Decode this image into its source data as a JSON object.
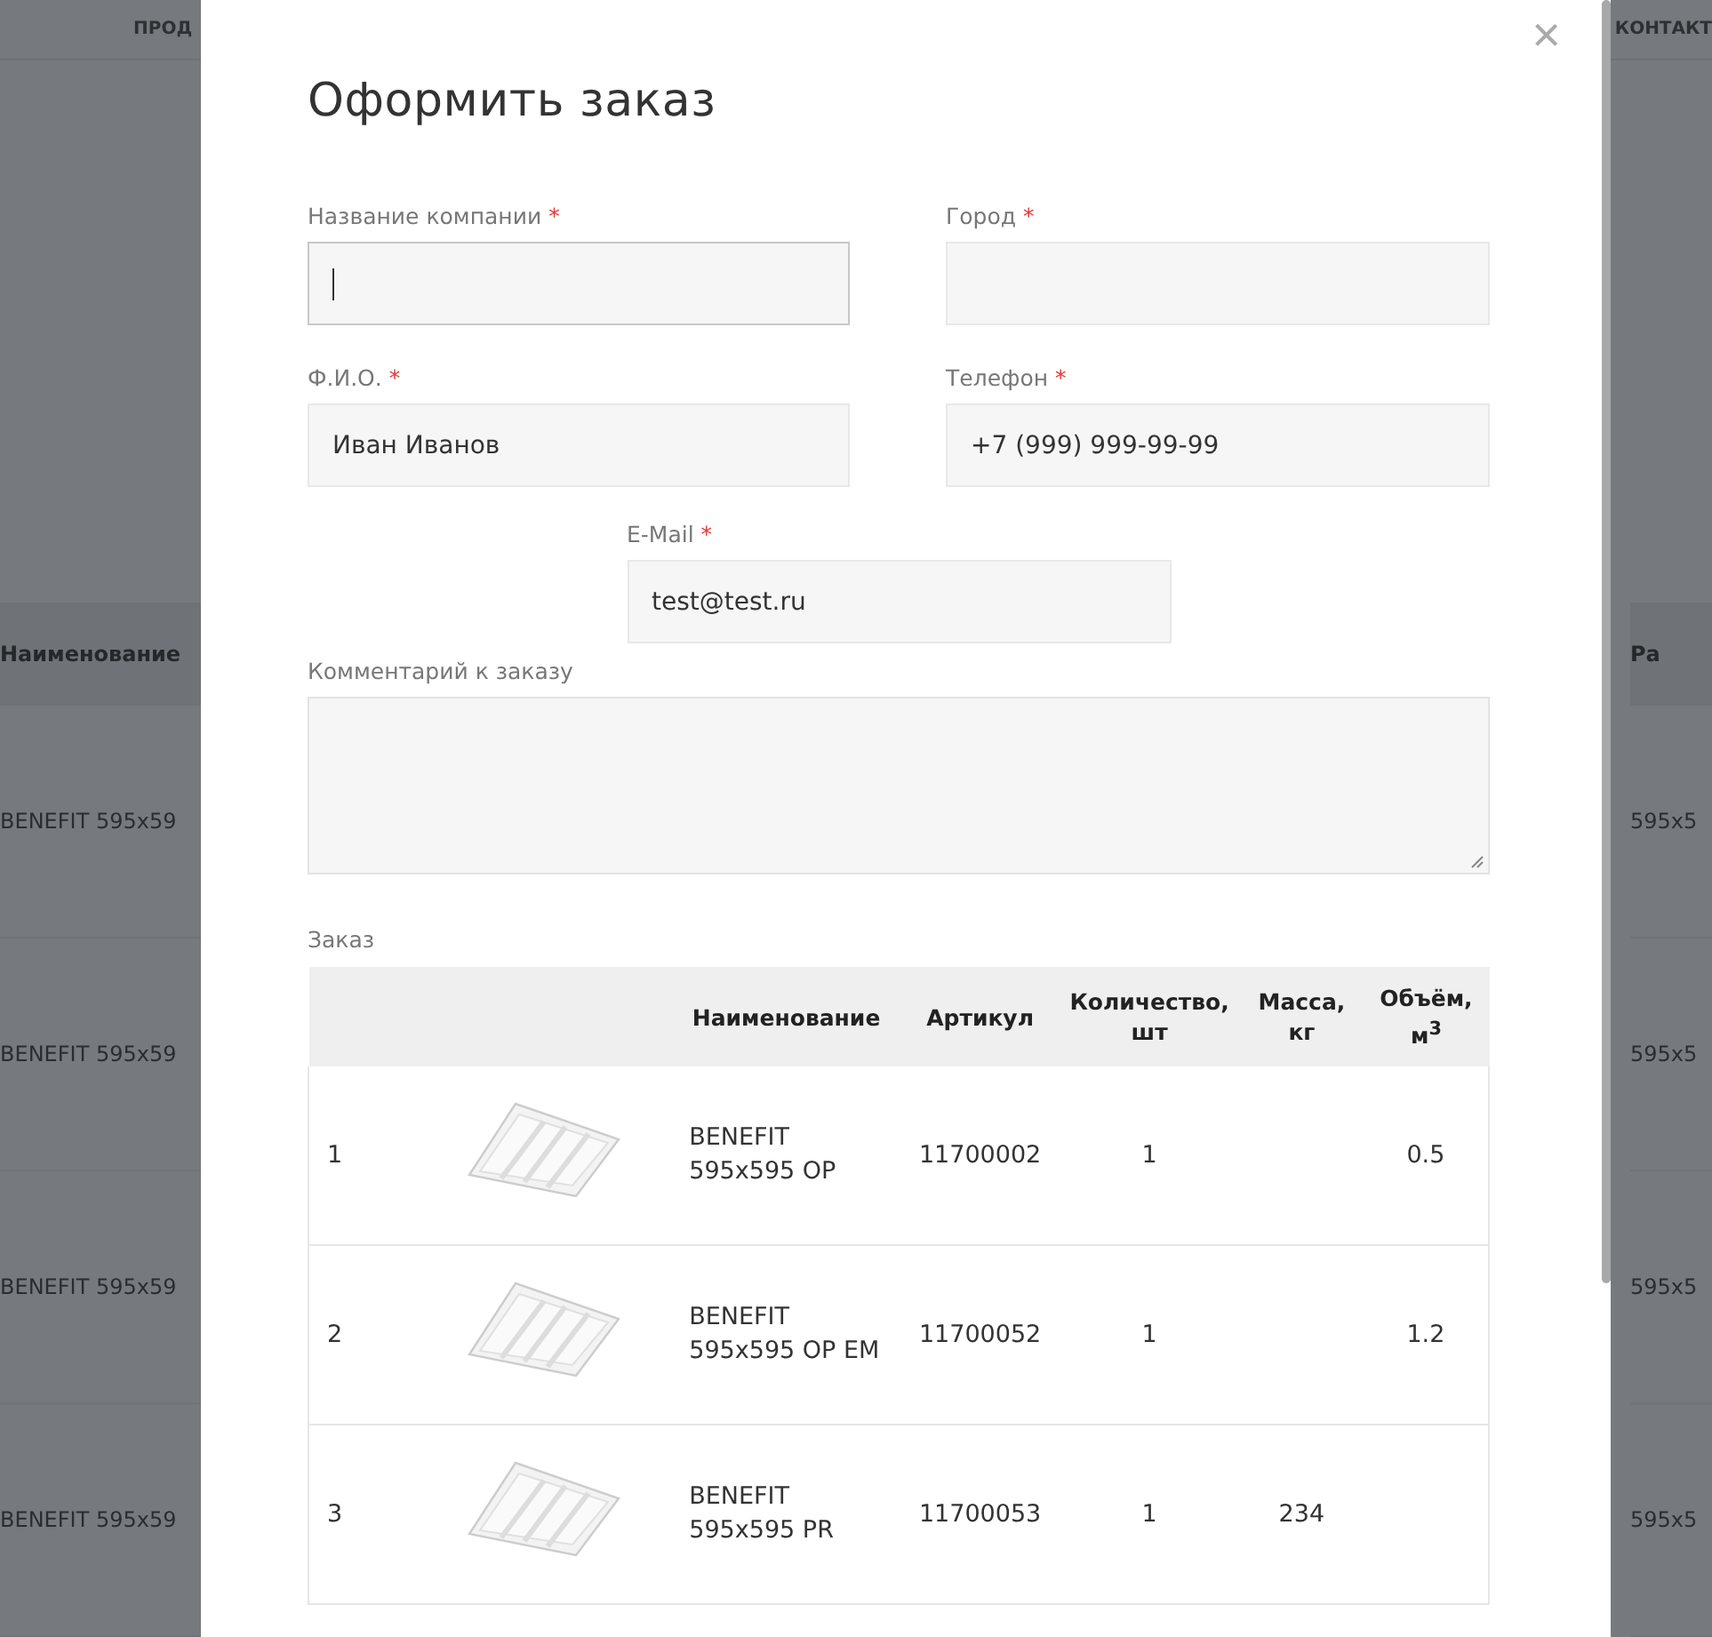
{
  "background_page": {
    "nav": [
      "ПРОД",
      "КОНТАКТ"
    ],
    "left_column": {
      "header": "Наименование",
      "rows": [
        "BENEFIT 595x59",
        "BENEFIT 595x59",
        "BENEFIT 595x59",
        "BENEFIT 595x59"
      ]
    },
    "right_column": {
      "header": "Ра",
      "rows": [
        "595x5",
        "595x5",
        "595x5",
        "595x5"
      ]
    }
  },
  "modal": {
    "title": "Оформить заказ",
    "close": "×",
    "fields": [
      {
        "label": "Название компании",
        "required_mark": "*",
        "focused": true
      },
      {
        "label": "Город",
        "required_mark": "*",
        "focused": false
      },
      {
        "label": "Ф.И.О.",
        "required_mark": "*",
        "value": "Иван Иванов",
        "focused": false
      },
      {
        "label": "Телефон",
        "required_mark": "*",
        "value": "+7 (999) 999-99-99",
        "focused": false
      },
      {
        "label": "E-Mail",
        "required_mark": "*",
        "value": "test@test.ru",
        "focused": false
      }
    ],
    "comment": {
      "label": "Комментарий к заказу"
    },
    "order": {
      "label": "Заказ",
      "columns": [
        "",
        "",
        "Наименование",
        "Артикул",
        "Количество, шт",
        "Масса, кг",
        "Объём, м$^{3}$"
      ],
      "rows": [
        {
          "index": "1",
          "name": "BENEFIT 595x595 OP",
          "article": "11700002",
          "quantity": "1",
          "volume": "0.5"
        },
        {
          "index": "2",
          "name": "BENEFIT 595x595 OP EM",
          "article": "11700052",
          "quantity": "1",
          "volume": "1.2"
        },
        {
          "index": "3",
          "name": "BENEFIT 595x595 PR",
          "article": "11700053",
          "quantity": "1",
          "mass": "234"
        }
      ]
    }
  }
}
